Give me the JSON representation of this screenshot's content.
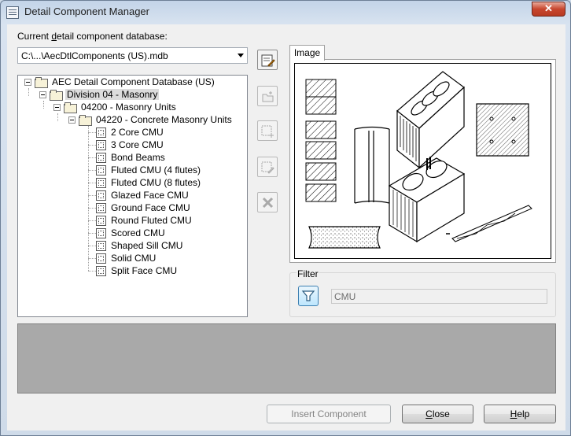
{
  "window": {
    "title": "Detail Component Manager",
    "close_glyph": "✕"
  },
  "database": {
    "label_pre": "Current ",
    "label_mnemonic": "d",
    "label_post": "etail component database:",
    "value": "C:\\...\\AecDtlComponents (US).mdb"
  },
  "tree": {
    "root": "AEC Detail Component Database (US)",
    "division": "Division 04 - Masonry",
    "section": "04200 - Masonry Units",
    "subsection": "04220 - Concrete Masonry Units",
    "items": [
      "2 Core CMU",
      "3 Core CMU",
      "Bond Beams",
      "Fluted CMU (4 flutes)",
      "Fluted CMU (8 flutes)",
      "Glazed Face CMU",
      "Ground Face CMU",
      "Round Fluted CMU",
      "Scored CMU",
      "Shaped Sill CMU",
      "Solid CMU",
      "Split Face CMU"
    ]
  },
  "toolbar": {
    "icons": [
      "edit-database-icon",
      "open-database-icon",
      "new-component-icon",
      "edit-component-icon",
      "delete-icon"
    ]
  },
  "image_tab": {
    "label": "Image"
  },
  "filter": {
    "label": "Filter",
    "value": "CMU"
  },
  "buttons": {
    "insert": "Insert Component",
    "close_mnemonic": "C",
    "close_rest": "lose",
    "help_mnemonic": "H",
    "help_rest": "elp"
  },
  "colors": {
    "selection": "#dcdcdc",
    "description_panel": "#a9a9a9",
    "close_button": "#c7462e"
  }
}
